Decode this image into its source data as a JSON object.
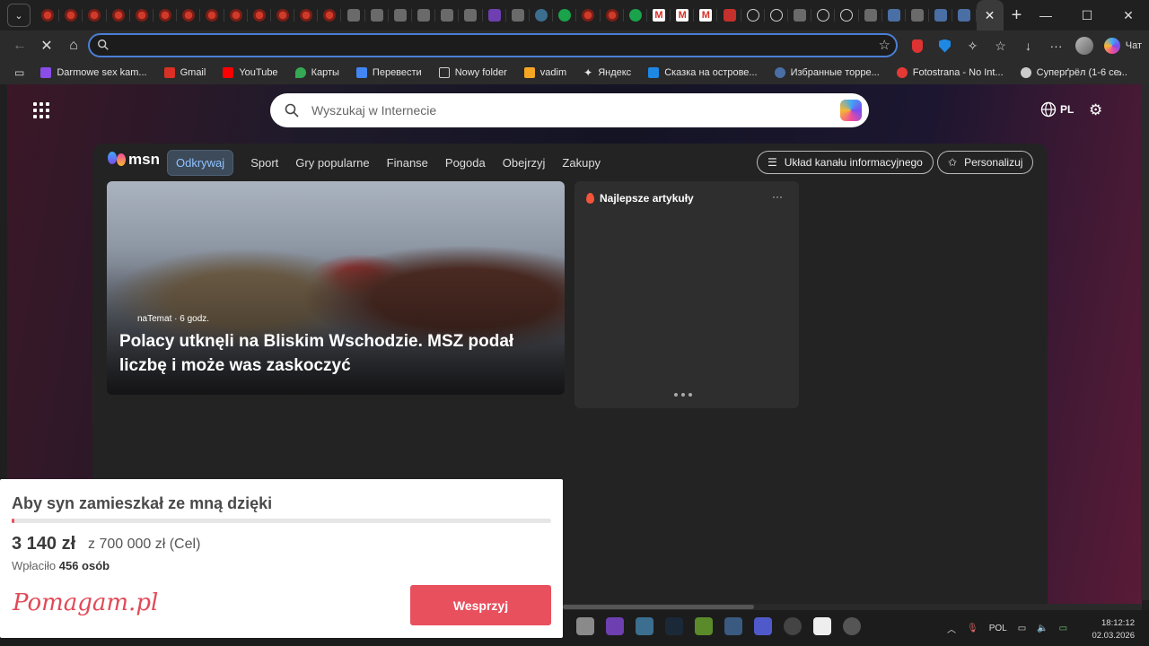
{
  "browser": {
    "address_value": "",
    "chat_label": "Чат",
    "bookmarks": [
      {
        "label": "Darmowe sex kam...",
        "color": "#8a4de8"
      },
      {
        "label": "Gmail",
        "color": "#d93025"
      },
      {
        "label": "YouTube",
        "color": "#ff0000"
      },
      {
        "label": "Карты",
        "color": "#34a853"
      },
      {
        "label": "Перевести",
        "color": "#4285f4"
      },
      {
        "label": "Nowy folder",
        "color": "#cccccc"
      },
      {
        "label": "vadim",
        "color": "#f5a623"
      },
      {
        "label": "Яндекс",
        "color": "#ffffff"
      },
      {
        "label": "Сказка на острове...",
        "color": "#1e88e5"
      },
      {
        "label": "Избранные торре...",
        "color": "#4a6fa5"
      },
      {
        "label": "Fotostrana - No Int...",
        "color": "#e53935"
      },
      {
        "label": "Суперґрёл (1-6 се...",
        "color": "#cccccc"
      }
    ]
  },
  "search": {
    "placeholder": "Wyszukaj w Internecie"
  },
  "header": {
    "lang": "PL"
  },
  "msn": {
    "logo_text": "msn",
    "tabs": [
      "Odkrywaj",
      "Sport",
      "Gry popularne",
      "Finanse",
      "Pogoda",
      "Obejrzyj",
      "Zakupy"
    ],
    "feed_layout_label": "Układ kanału informacyjnego",
    "personalize_label": "Personalizuj"
  },
  "hero": {
    "source": "naTemat",
    "time": "· 6 godz.",
    "headline": "Polacy utknęli na Bliskim Wschodzie. MSZ podał liczbę i może was zaskoczyć"
  },
  "top_articles": {
    "title": "Najlepsze artykuły",
    "more": "···"
  },
  "donation": {
    "title": "Aby syn zamieszkał ze mną dzięki",
    "amount": "3 140 zł",
    "goal": "z 700 000 zł (Cel)",
    "paid_prefix": "Wpłaciło",
    "paid_count": "456 osób",
    "progress_fraction": 0.0045,
    "logo": "Pomagam.pl",
    "button": "Wesprzyj",
    "accent": "#e8505e"
  },
  "taskbar": {
    "lang": "POL",
    "time": "18:12:12",
    "date": "02.03.2026"
  }
}
